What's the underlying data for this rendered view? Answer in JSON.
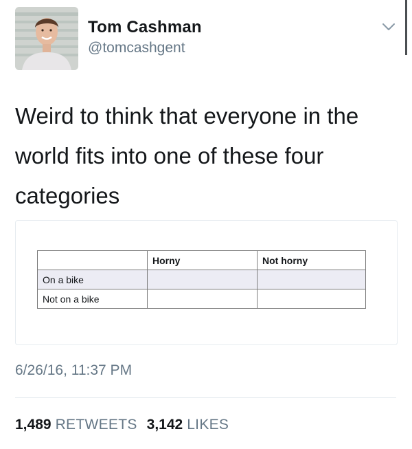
{
  "author": {
    "name": "Tom Cashman",
    "handle": "@tomcashgent",
    "avatar_icon": "profile-photo"
  },
  "tweet": {
    "text_lines": [
      "Weird to think that everyone in the",
      "world fits into one of these four",
      "categories"
    ],
    "timestamp": "6/26/16, 11:37 PM"
  },
  "table": {
    "header": [
      "",
      "Horny",
      "Not horny"
    ],
    "rows": [
      [
        "On a bike",
        "",
        ""
      ],
      [
        "Not on a bike",
        "",
        ""
      ]
    ]
  },
  "stats": {
    "retweets_count": "1,489",
    "retweets_label": "RETWEETS",
    "likes_count": "3,142",
    "likes_label": "LIKES"
  },
  "colors": {
    "text": "#14171a",
    "secondary": "#657786",
    "row_shade": "#ececf4"
  }
}
